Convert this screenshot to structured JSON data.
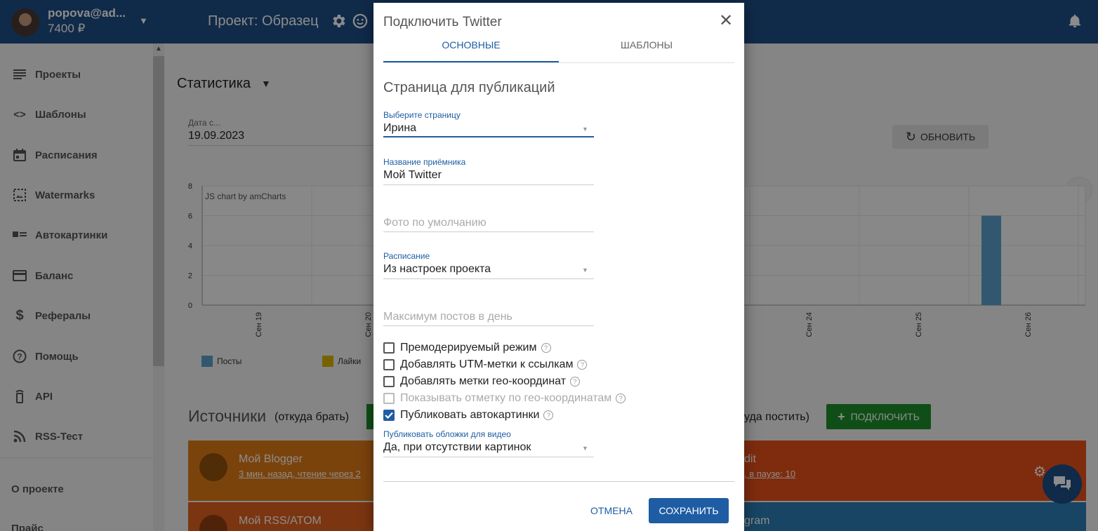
{
  "header": {
    "user_email": "popova@ad...",
    "user_balance": "7400 ₽",
    "project_title": "Проект: Образец"
  },
  "sidebar": {
    "items": [
      {
        "label": "Проекты",
        "icon": "list-icon"
      },
      {
        "label": "Шаблоны",
        "icon": "code-icon"
      },
      {
        "label": "Расписания",
        "icon": "calendar-icon"
      },
      {
        "label": "Watermarks",
        "icon": "watermark-icon"
      },
      {
        "label": "Автокартинки",
        "icon": "image-text-icon"
      },
      {
        "label": "Баланс",
        "icon": "credit-card-icon"
      },
      {
        "label": "Рефералы",
        "icon": "dollar-icon"
      },
      {
        "label": "Помощь",
        "icon": "help-icon"
      },
      {
        "label": "API",
        "icon": "api-icon"
      },
      {
        "label": "RSS-Тест",
        "icon": "rss-icon"
      }
    ],
    "about": "О проекте",
    "price": "Прайс"
  },
  "main": {
    "stat_title": "Статистика",
    "date_label": "Дата с...",
    "date_value": "19.09.2023",
    "refresh_label": "ОБНОВИТЬ",
    "sources_title": "Источники",
    "sources_sub": "(откуда брать)",
    "dest_sub": "уда постить)",
    "connect_label": "ПОДКЛЮЧИТЬ",
    "cards": [
      {
        "title": "Мой Blogger",
        "sub": "3 мин. назад, чтение через 2"
      },
      {
        "title": "dit",
        "sub": ", в паузе: 10"
      },
      {
        "title": "Мой RSS/ATOM",
        "sub": ""
      },
      {
        "title": "gram",
        "sub": ""
      }
    ]
  },
  "chart_data": {
    "type": "bar",
    "watermark": "JS chart by amCharts",
    "y_ticks": [
      "8",
      "6",
      "4",
      "2",
      "0"
    ],
    "ylim": [
      0,
      8
    ],
    "x_ticks": [
      "Сен 19",
      "Сен 20",
      "Сен 24",
      "Сен 25",
      "Сен 26"
    ],
    "series": [
      {
        "name": "Посты",
        "color": "#5aa0cc",
        "values": [
          {
            "x": "Сен 26",
            "y": 6
          }
        ]
      },
      {
        "name": "Лайки",
        "color": "#d9b200",
        "values": []
      }
    ]
  },
  "dialog": {
    "title": "Подключить Twitter",
    "tabs": [
      "ОСНОВНЫЕ",
      "ШАБЛОНЫ"
    ],
    "section_title": "Страница для публикаций",
    "page_label": "Выберите страницу",
    "page_value": "Ирина",
    "name_label": "Название приёмника",
    "name_value": "Мой Twitter",
    "photo_placeholder": "Фото по умолчанию",
    "schedule_label": "Расписание",
    "schedule_value": "Из настроек проекта",
    "max_posts_placeholder": "Максимум постов в день",
    "checkboxes": [
      {
        "label": "Премодерируемый режим",
        "checked": false,
        "disabled": false
      },
      {
        "label": "Добавлять UTM-метки к ссылкам",
        "checked": false,
        "disabled": false
      },
      {
        "label": "Добавлять метки гео-координат",
        "checked": false,
        "disabled": false
      },
      {
        "label": "Показывать отметку по гео-координатам",
        "checked": false,
        "disabled": true
      },
      {
        "label": "Публиковать автокартинки",
        "checked": true,
        "disabled": false
      }
    ],
    "video_label": "Публиковать обложки для видео",
    "video_value": "Да, при отсутствии картинок",
    "cancel_label": "ОТМЕНА",
    "save_label": "СОХРАНИТЬ"
  }
}
